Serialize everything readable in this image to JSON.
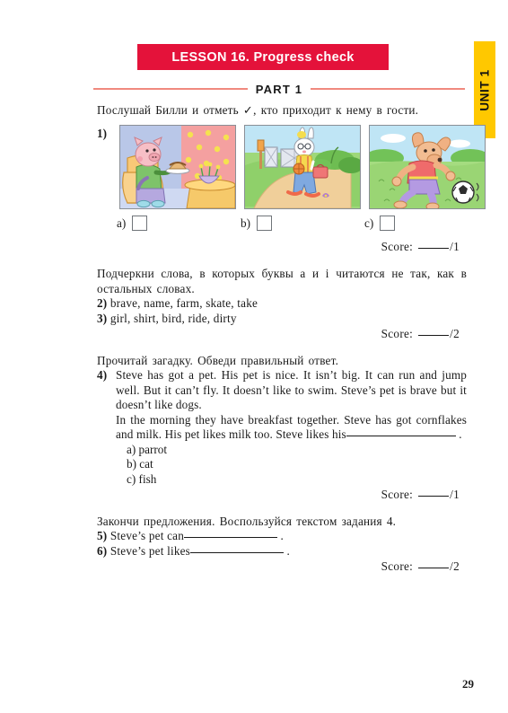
{
  "unit_tab": {
    "label": "UNIT 1",
    "background": "#FFC800",
    "text_color": "#111111"
  },
  "banner": {
    "label": "LESSON 16. Progress check",
    "background": "#E4123A",
    "text_color": "#FFFFFF"
  },
  "divider": {
    "label": "PART 1",
    "rule_color": "#F0897E"
  },
  "tasks": [
    {
      "prompt": "Послушай Билли и отметь ✓, кто приходит к нему в гости.",
      "number": "1)",
      "pictures": [
        {
          "alt": "pig sitting in armchair holding a cake"
        },
        {
          "alt": "rabbit walking along a path with a basketball and bag"
        },
        {
          "alt": "dog running after a football in a field"
        }
      ],
      "options": [
        {
          "label": "a)",
          "checked": false
        },
        {
          "label": "b)",
          "checked": false
        },
        {
          "label": "c)",
          "checked": false
        }
      ],
      "score_label": "Score:",
      "score_max": "/1"
    },
    {
      "prompt": "Подчеркни слова, в которых буквы a и i читаются не так, как в остальных словах.",
      "lines": [
        {
          "number": "2)",
          "text": "brave, name, farm, skate, take"
        },
        {
          "number": "3)",
          "text": "girl, shirt, bird, ride, dirty"
        }
      ],
      "score_label": "Score:",
      "score_max": "/2"
    },
    {
      "prompt": "Прочитай загадку. Обведи правильный ответ.",
      "number": "4)",
      "paragraph1": "Steve has got a pet. His pet is nice. It isn’t big. It can run and jump well. But it can’t fly. It doesn’t like to swim. Steve’s pet is brave but it doesn’t like dogs.",
      "paragraph2_before": "In the morning they have breakfast together. Steve has got cornflakes and milk. His pet likes milk too. Steve likes his",
      "paragraph2_after": ".",
      "answers": [
        {
          "label": "a)",
          "text": "parrot"
        },
        {
          "label": "b)",
          "text": "cat"
        },
        {
          "label": "c)",
          "text": "fish"
        }
      ],
      "score_label": "Score:",
      "score_max": "/1"
    },
    {
      "prompt": "Закончи предложения. Воспользуйся текстом задания 4.",
      "lines": [
        {
          "number": "5)",
          "before": "Steve’s pet can",
          "after": "."
        },
        {
          "number": "6)",
          "before": "Steve’s pet likes",
          "after": "."
        }
      ],
      "score_label": "Score:",
      "score_max": "/2"
    }
  ],
  "page_number": "29"
}
